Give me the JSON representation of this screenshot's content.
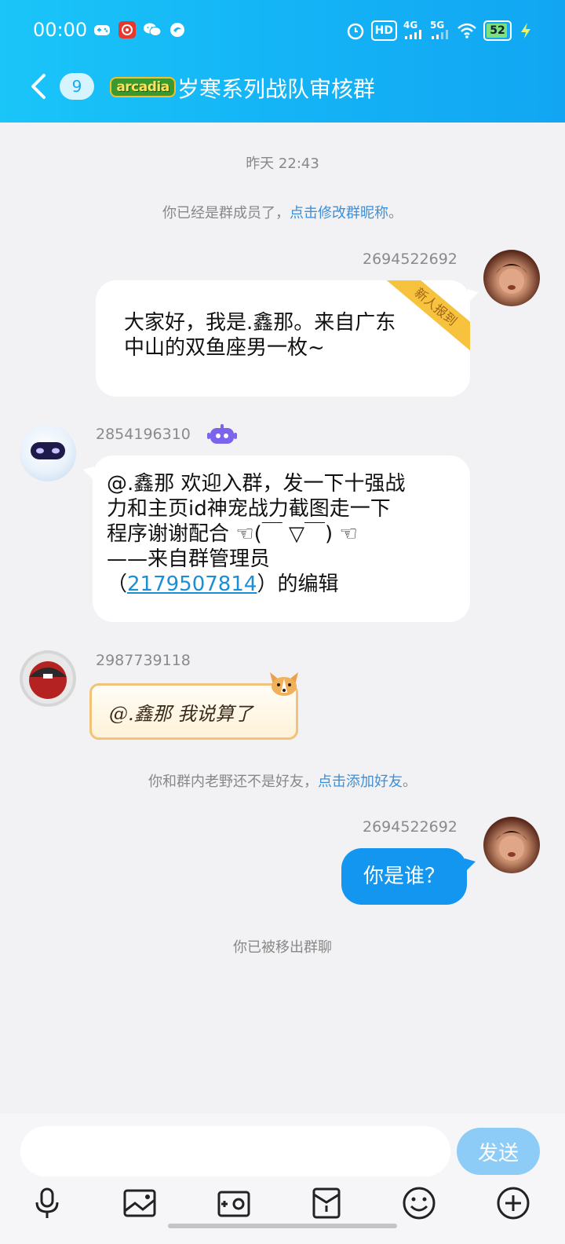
{
  "status_bar": {
    "time": "00:00",
    "hd_label": "HD",
    "net1": "4G",
    "net2": "5G",
    "battery": "52"
  },
  "header": {
    "unread_count": "9",
    "group_logo_text": "arcadia",
    "title": "岁寒系列战队审核群"
  },
  "chat": {
    "timestamp": "昨天 22:43",
    "system_join": {
      "text": "你已经是群成员了，",
      "link": "点击修改群昵称",
      "end": "。"
    },
    "messages": [
      {
        "sender": "2694522692",
        "line1": "大家好，我是.鑫那。来自广东",
        "line2": "中山的双鱼座男一枚~",
        "ribbon": "新人报到"
      },
      {
        "sender": "2854196310",
        "line1": "@.鑫那 欢迎入群，发一下十强战",
        "line2": "力和主页id神宠战力截图走一下",
        "line3": "程序谢谢配合 ☜(￣ ▽￣) ☜",
        "line4": "——来自群管理员",
        "line5_pre": "（",
        "line5_link": "2179507814",
        "line5_post": "）的编辑"
      },
      {
        "sender": "2987739118",
        "text": "@.鑫那 我说算了"
      },
      {
        "sender": "2694522692",
        "text": "你是谁？"
      }
    ],
    "system_friend": {
      "text": "你和群内老野还不是好友，",
      "link": "点击添加好友",
      "end": "。"
    },
    "system_removed": "你已被移出群聊"
  },
  "input": {
    "placeholder": "",
    "send_label": "发送"
  },
  "colors": {
    "header_start": "#1ac5f8",
    "header_end": "#12a6f2",
    "bubble_blue": "#1296f0",
    "link": "#3d8fd8",
    "send_button": "#8cccf6"
  },
  "icons": [
    "back-chevron-icon",
    "microphone-icon",
    "image-icon",
    "camera-icon",
    "red-packet-icon",
    "emoji-icon",
    "plus-icon",
    "robot-badge-icon"
  ]
}
